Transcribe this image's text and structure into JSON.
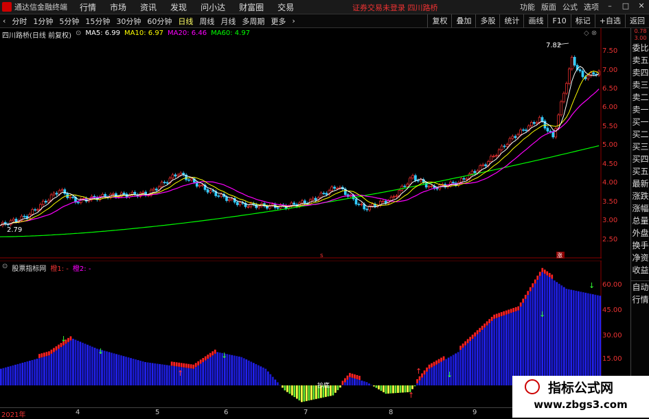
{
  "topbar": {
    "app_title": "通达信金融终端",
    "menus": [
      "行情",
      "市场",
      "资讯",
      "发现",
      "问小达",
      "财富圈",
      "交易"
    ],
    "notice": "证券交易未登录   四川路桥",
    "right": [
      "功能",
      "版面",
      "公式",
      "选项"
    ]
  },
  "toolbar": {
    "periods": [
      "分时",
      "1分钟",
      "5分钟",
      "15分钟",
      "30分钟",
      "60分钟",
      "日线",
      "周线",
      "月线",
      "多周期",
      "更多"
    ],
    "active": "日线",
    "right": [
      "复权",
      "叠加",
      "多股",
      "统计",
      "画线",
      "F10",
      "标记",
      "+自选",
      "返回"
    ]
  },
  "main_legend": {
    "name": "四川路桥(日线 前复权)",
    "ma5": "MA5: 6.99",
    "ma10": "MA10: 6.97",
    "ma20": "MA20: 6.46",
    "ma60": "MA60: 4.97",
    "colors": {
      "ma5": "#ffffff",
      "ma10": "#ffff00",
      "ma20": "#ff00ff",
      "ma60": "#00ff00"
    }
  },
  "main_yaxis": [
    "7.50",
    "7.00",
    "6.50",
    "6.00",
    "5.50",
    "5.00",
    "4.50",
    "4.00",
    "3.50",
    "3.00",
    "2.50"
  ],
  "sub_legend": {
    "name": "股票指标网",
    "l1": "橙1: -",
    "l2": "橙2: -"
  },
  "sub_yaxis": [
    "60.00",
    "45.00",
    "30.00",
    "15.00"
  ],
  "annotations": {
    "high": "7.82",
    "low": "2.79"
  },
  "xaxis": [
    "2021年",
    "4",
    "5",
    "6",
    "7",
    "8",
    "9"
  ],
  "sidebar": [
    "委比",
    "卖五",
    "卖四",
    "卖三",
    "卖二",
    "卖一",
    "买一",
    "买二",
    "买三",
    "买四",
    "买五",
    "最新",
    "涨跌",
    "涨幅",
    "总量",
    "外盘",
    "换手",
    "净资",
    "收益"
  ],
  "sidebar2": [
    "自动",
    "行情"
  ],
  "watermark": {
    "line1": "指标公式网",
    "line2": "www.zbgs3.com"
  }
}
